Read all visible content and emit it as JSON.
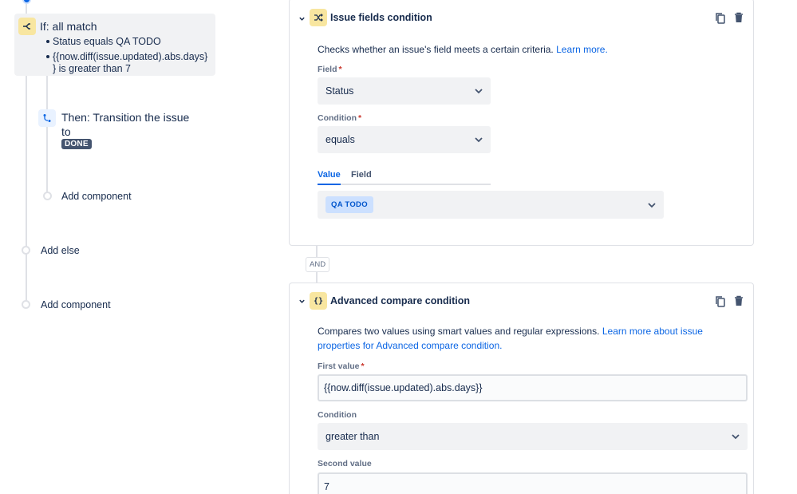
{
  "rule": {
    "if_title": "If: all match",
    "conditions": [
      "Status equals QA TODO",
      "{{now.diff(issue.updated).abs.days}",
      "} is greater than 7"
    ],
    "then_title_line1": "Then: Transition the issue",
    "then_title_line2": "to",
    "then_status": "DONE",
    "add_component_inner": "Add component",
    "add_else": "Add else",
    "add_component_outer": "Add component"
  },
  "panel1": {
    "title": "Issue fields condition",
    "description": "Checks whether an issue's field meets a certain criteria.",
    "learn_more": "Learn more.",
    "field_label": "Field",
    "field_value": "Status",
    "condition_label": "Condition",
    "condition_value": "equals",
    "tab_value": "Value",
    "tab_field": "Field",
    "value_chip": "QA TODO"
  },
  "connector": "AND",
  "panel2": {
    "title": "Advanced compare condition",
    "description": "Compares two values using smart values and regular expressions.",
    "learn_more_1": "Learn more about issue",
    "learn_more_2": "properties for Advanced compare condition.",
    "first_label": "First value",
    "first_value": "{{now.diff(issue.updated).abs.days}}",
    "condition_label": "Condition",
    "condition_value": "greater than",
    "second_label": "Second value",
    "second_value": "7"
  },
  "colors": {
    "accent": "#0c66e4",
    "required": "#c9372c",
    "condition_badge": "#f8e6a0",
    "action_badge": "#e9f2ff",
    "lozenge": "#44546f"
  },
  "icons": {
    "if_badge": "branch-icon",
    "then_badge": "transition-icon",
    "panel1_badge": "shuffle-icon",
    "panel2_badge": "braces-icon",
    "copy": "copy-icon",
    "delete": "trash-icon",
    "collapse": "chevron-down-icon"
  }
}
